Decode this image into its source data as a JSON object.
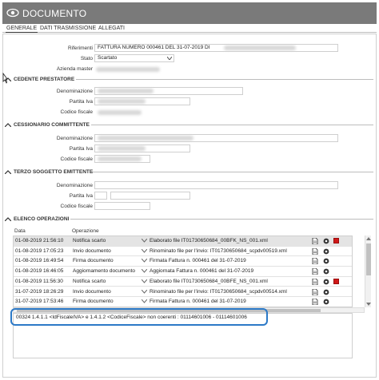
{
  "window": {
    "title": "DOCUMENTO"
  },
  "tabs": [
    "GENERALE",
    "DATI TRASMISSIONE",
    "ALLEGATI"
  ],
  "generale": {
    "riferimenti_label": "Riferimenti",
    "riferimenti_value": "FATTURA NUMERO 000461 DEL 31-07-2019 DI",
    "stato_label": "Stato",
    "stato_value": "Scartato",
    "azienda_label": "Azienda master"
  },
  "cedente": {
    "title": "CEDENTE PRESTATORE",
    "denominazione_label": "Denominazione",
    "partita_iva_label": "Partita Iva",
    "codice_fiscale_label": "Codice fiscale"
  },
  "cessionario": {
    "title": "CESSIONARIO COMMITTENTE",
    "denominazione_label": "Denominazione",
    "partita_iva_label": "Partita Iva",
    "codice_fiscale_label": "Codice fiscale"
  },
  "terzo": {
    "title": "TERZO SOGGETTO EMITTENTE",
    "denominazione_label": "Denominazione",
    "partita_iva_label": "Partita Iva",
    "codice_fiscale_label": "Codice fiscale"
  },
  "operazioni": {
    "title": "ELENCO OPERAZIONI",
    "col_data": "Data",
    "col_operazione": "Operazione",
    "rows": [
      {
        "date": "01-08-2019 21:56:10",
        "op": "Notifica scarto",
        "desc": "Elaborato file IT01730650684_00BFK_NS_001.xml",
        "red": true
      },
      {
        "date": "01-08-2019 17:05:23",
        "op": "Invio documento",
        "desc": "Rinominato file per l'invio: IT01730650684_scpdv00519.xml",
        "red": false
      },
      {
        "date": "01-08-2019 16:49:54",
        "op": "Firma documento",
        "desc": "Firmata Fattura n. 000461 del 31-07-2019",
        "red": false
      },
      {
        "date": "01-08-2019 16:46:05",
        "op": "Aggiornamento documento",
        "desc": "Aggiornata Fattura n. 000461 del 31-07-2019",
        "red": false
      },
      {
        "date": "01-08-2019 11:56:30",
        "op": "Notifica scarto",
        "desc": "Elaborato file IT01730650684_00BFE_NS_001.xml",
        "red": true
      },
      {
        "date": "31-07-2019 18:26:29",
        "op": "Invio documento",
        "desc": "Rinominato file per l'invio: IT01730650684_scpdv00514.xml",
        "red": false
      },
      {
        "date": "31-07-2019 17:53:46",
        "op": "Firma documento",
        "desc": "Firmata Fattura n. 000461 del 31-07-2019",
        "red": false
      }
    ],
    "message": "00324 1.4.1.1 <IdFiscaleIVA> e 1.4.1.2 <CodiceFiscale> non coerenti : 01114601006 - 01114601006"
  },
  "colors": {
    "titlebar": "#7a7a7a",
    "highlight": "#2c79c7",
    "error": "#d01818"
  },
  "icons": [
    "eye-icon",
    "chevron-down-icon",
    "document-icon",
    "gear-icon",
    "red-flag-icon"
  ]
}
